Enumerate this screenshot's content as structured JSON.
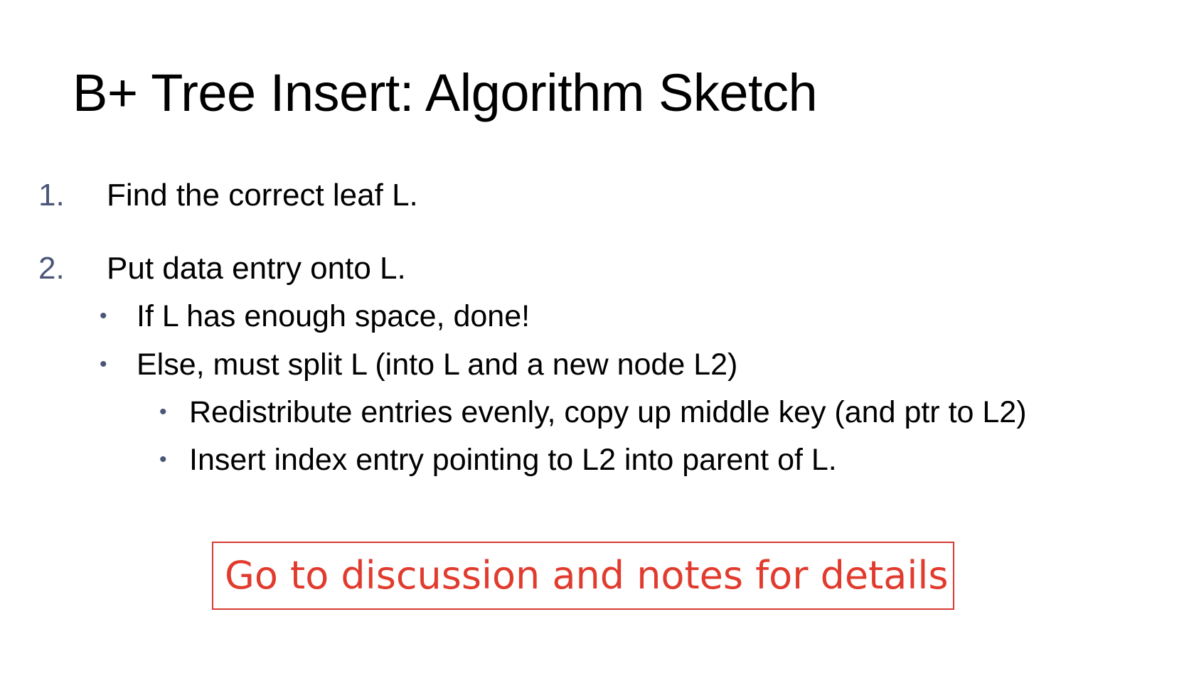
{
  "slide": {
    "title": "B+ Tree Insert: Algorithm Sketch",
    "steps": [
      {
        "number": "1.",
        "text": "Find the correct leaf L."
      },
      {
        "number": "2.",
        "text": "Put data entry onto L.",
        "bullets": [
          {
            "text": "If L has enough space, done!"
          },
          {
            "text": "Else, must split L (into L and a new node L2)",
            "bullets": [
              {
                "text": "Redistribute entries evenly, copy up middle key (and ptr to L2)"
              },
              {
                "text": "Insert index entry pointing to L2 into parent of L."
              }
            ]
          }
        ]
      }
    ],
    "callout": {
      "text": "Go to discussion and notes for details",
      "color": "#e13b2e",
      "border_color": "#d63a32"
    },
    "colors": {
      "number_color": "#4a5578",
      "text_color": "#000000",
      "background": "#ffffff"
    },
    "bullet_symbol": "•"
  }
}
